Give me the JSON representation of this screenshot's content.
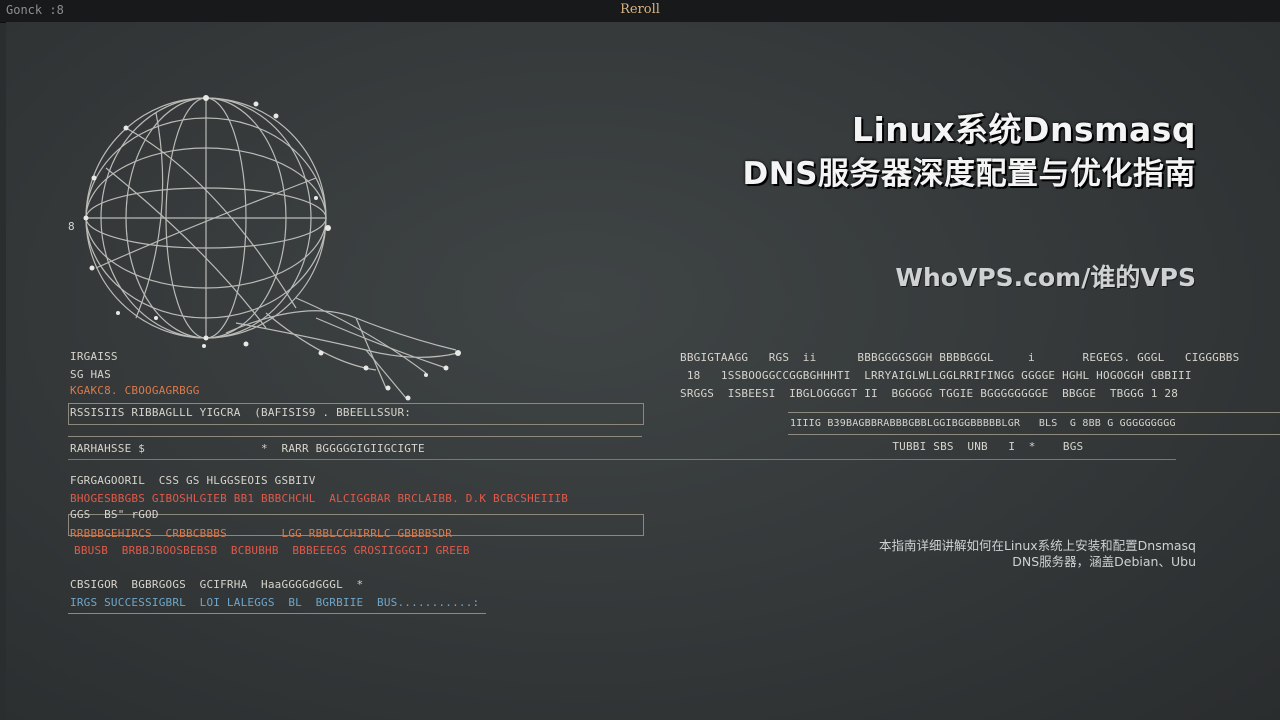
{
  "window": {
    "title_left": "Gonck :8",
    "title_center": "Reroll"
  },
  "article": {
    "title_line1": "Linux系统Dnsmasq",
    "title_line2": "DNS服务器深度配置与优化指南",
    "site": "WhoVPS.com/谁的VPS",
    "desc_line1": "本指南详细讲解如何在Linux系统上安装和配置Dnsmasq",
    "desc_line2": "DNS服务器，涵盖Debian、Ubu"
  },
  "globe": {
    "label_left": "8"
  },
  "terminal_left": {
    "lines": [
      "IRGAISS",
      "SG HAS",
      "KGAKC8. CBOOGAGRBGG",
      "RSSISIIS RIBBAGLLL YIGCRA  (BAFISIS9 . BBEELLSSUR:",
      "RARHAHSSE $                 *  RARR BGGGGGIGIIGCIGTE",
      "FGRGAGOORIL  CSS GS HLGGSEOIS GSBIIV",
      "BHOGESBBGBS GIBOSHLGIEB BB1 BBBCHCHL  ALCIGGBAR BRCLAIBB. D.K BCBCSHEIIIB",
      "GGS  BS\" rGOD",
      "RRBBBGEHIRCS  CRBBCBBBS        LGG RBBLCCHIRRLC GBBBBSDR",
      "BBUSB  BRBBJBOOSBEBSB  BCBUBHB  BBBEEEGS GROSIIGGGIJ GREEB",
      "CBSIGOR  BGBRGOGS  GCIFRHA  HaaGGGGdGGGL  *",
      "IRGS SUCCESSIGBRL  LOI LALEGGS  BL  BGRBIIE  BUS...........:"
    ]
  },
  "terminal_right": {
    "lines": [
      "BBGIGTAAGG   RGS  ii      BBBGGGGSGGH BBBBGGGL     i       REGEGS. GGGL   CIGGGBBS",
      " 18   1SSBOOGGCCGGBGHHHTI  LRRYAIGLWLLGGLRRIFINGG GGGGE HGHL HOGOGGH GBBIII",
      "SRGGS  ISBEESI  IBGLOGGGGT II  BGGGGG TGGIE BGGGGGGGGE  BBGGE  TBGGG 1 28",
      "1IIIG B39BAGBBRABBBGBBLGGIBGGBBBBBLGR   BLS  G 8BB G GGGGGGGGG",
      "               TUBBI SBS  UNB   I  *    BGS"
    ]
  },
  "colors": {
    "background": "#2b2e2f",
    "title_text": "#f4f4f4",
    "accent_red": "#e05a4a",
    "accent_orange": "#d97a4c",
    "accent_green": "#a8b86c"
  }
}
